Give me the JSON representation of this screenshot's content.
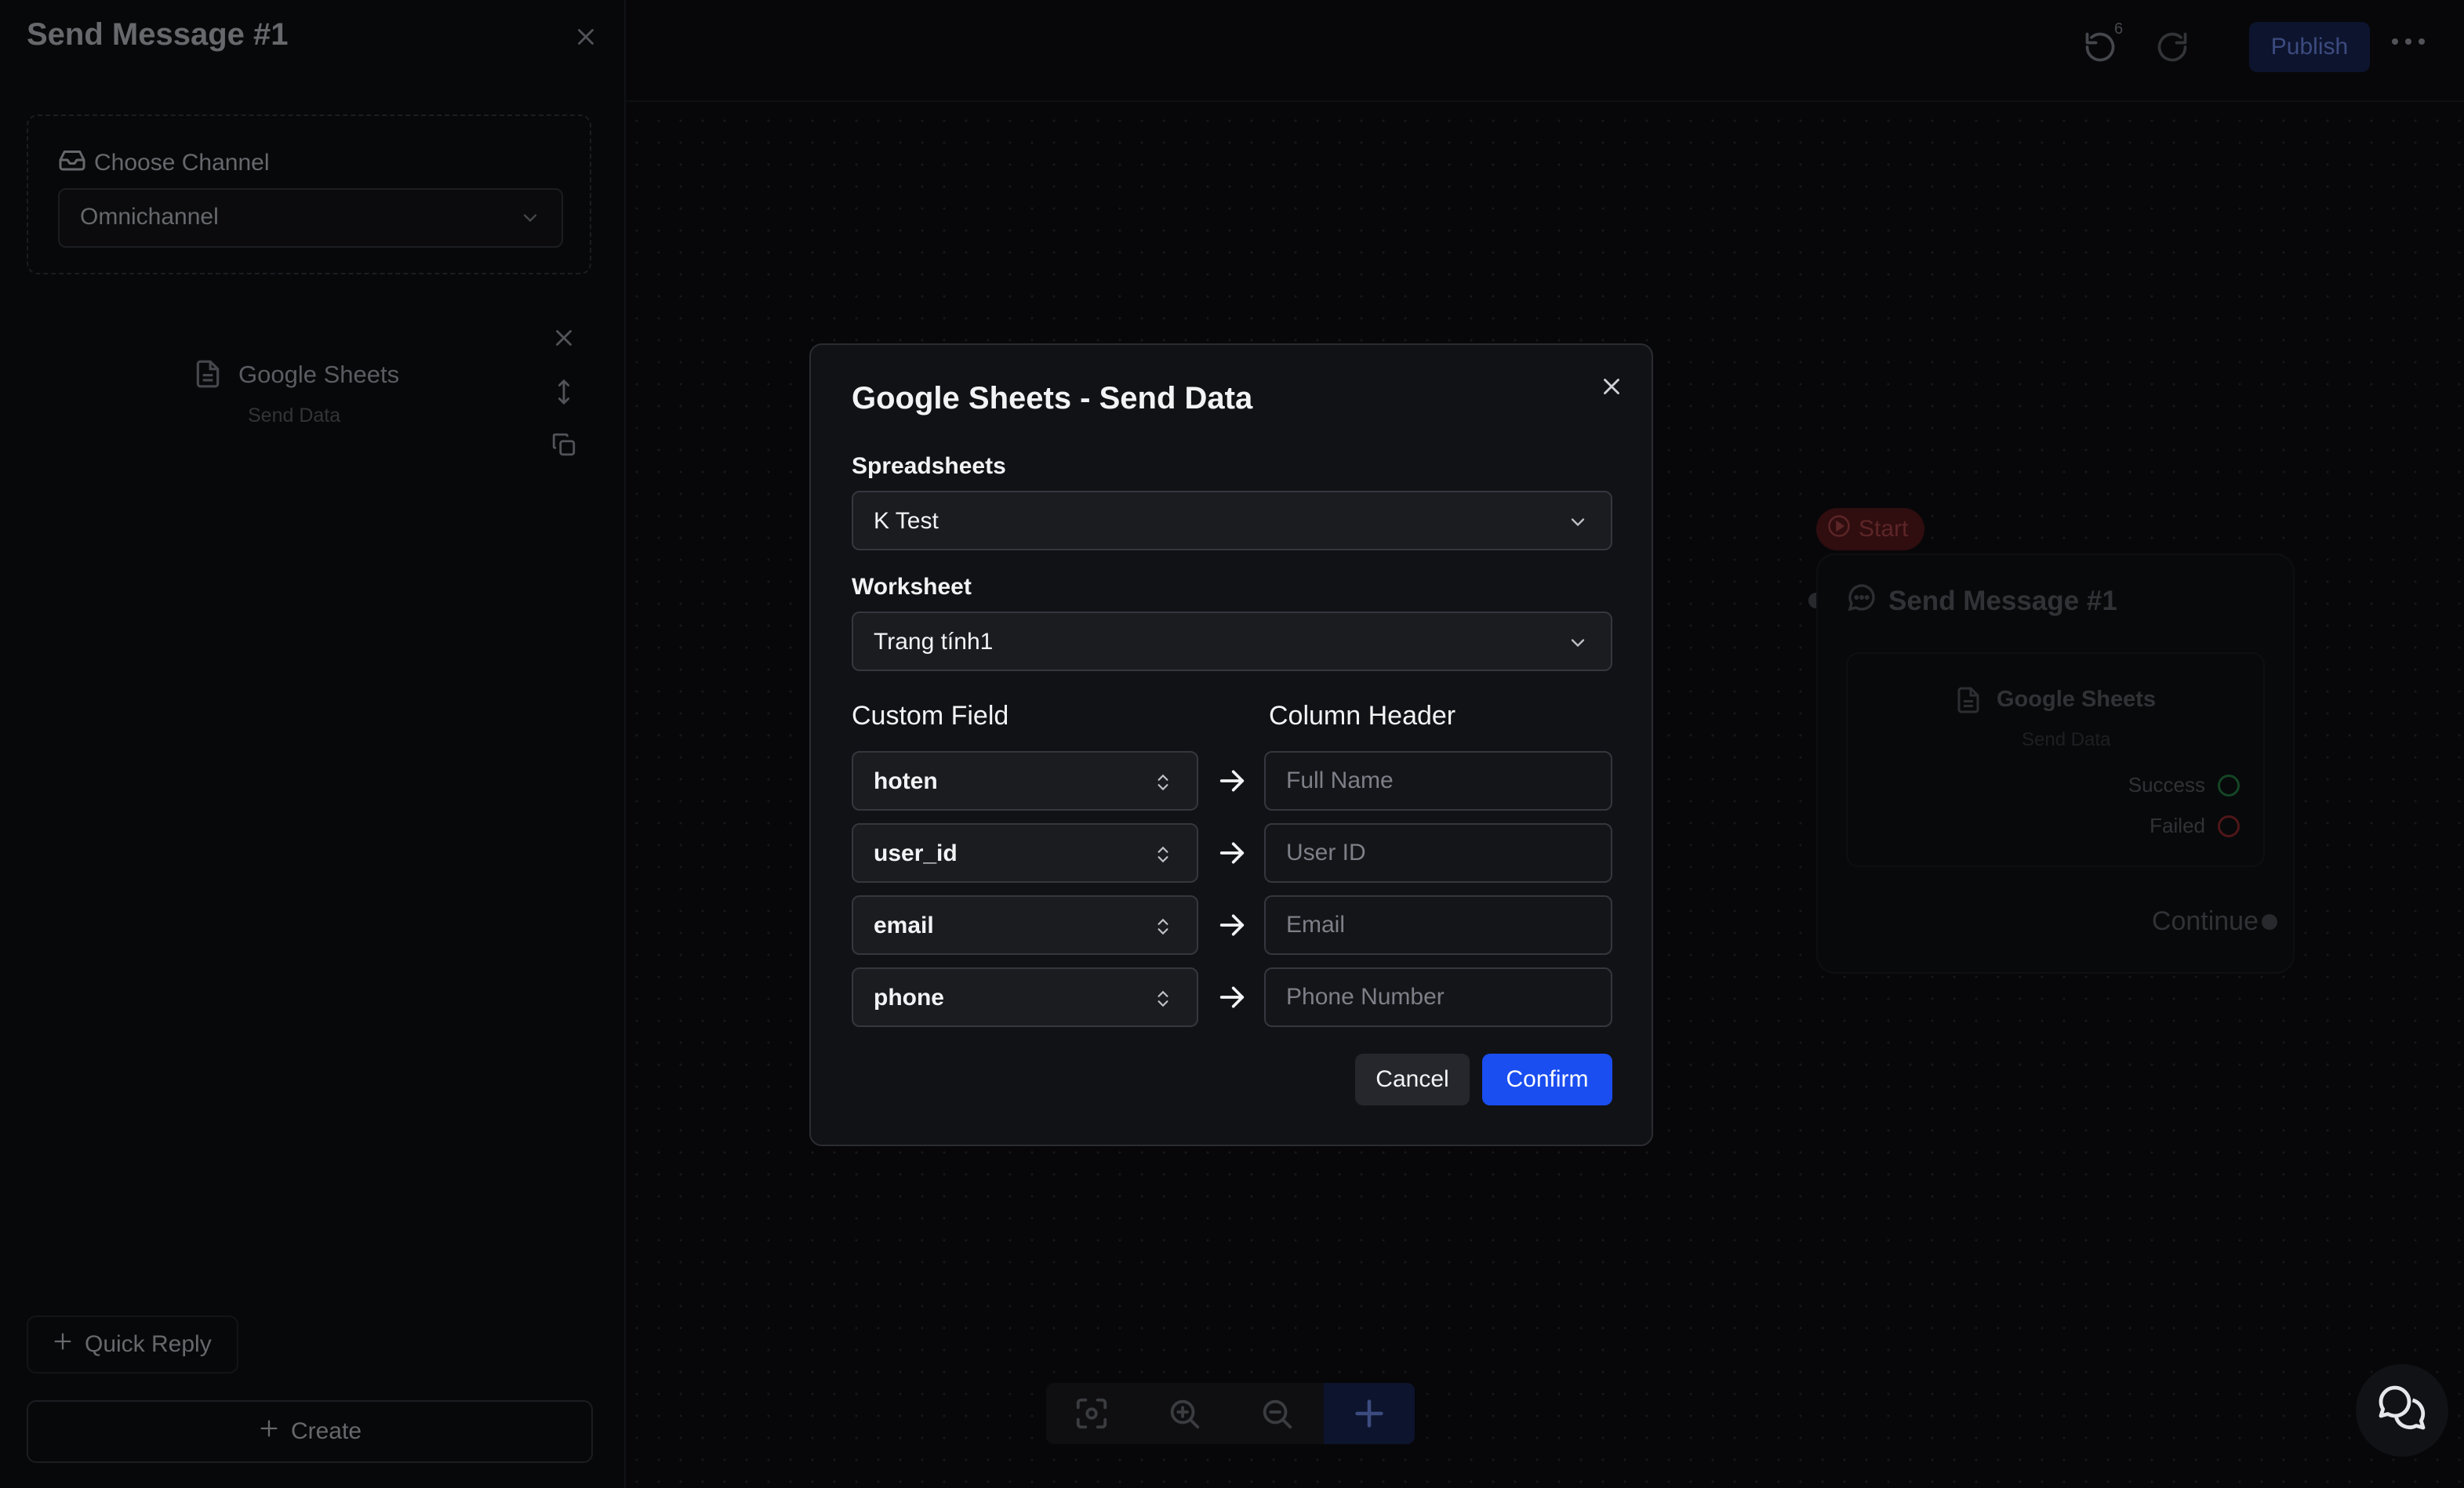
{
  "sidebar": {
    "title": "Send Message #1",
    "channel_label": "Choose Channel",
    "channel_value": "Omnichannel",
    "block_title": "Google Sheets",
    "block_subtitle": "Send Data",
    "quick_reply_label": "Quick Reply",
    "create_label": "Create"
  },
  "topbar": {
    "undo_count": "6",
    "publish_label": "Publish"
  },
  "flow": {
    "start_label": "Start",
    "node_title": "Send Message #1",
    "node_block_title": "Google Sheets",
    "node_block_subtitle": "Send Data",
    "success_label": "Success",
    "failed_label": "Failed",
    "continue_label": "Continue"
  },
  "modal": {
    "title": "Google Sheets - Send Data",
    "spreadsheets_label": "Spreadsheets",
    "spreadsheets_value": "K Test",
    "worksheet_label": "Worksheet",
    "worksheet_value": "Trang tính1",
    "custom_field_header": "Custom Field",
    "column_header_header": "Column Header",
    "rows": [
      {
        "field": "hoten",
        "placeholder": "Full Name"
      },
      {
        "field": "user_id",
        "placeholder": "User ID"
      },
      {
        "field": "email",
        "placeholder": "Email"
      },
      {
        "field": "phone",
        "placeholder": "Phone Number"
      }
    ],
    "cancel_label": "Cancel",
    "confirm_label": "Confirm"
  },
  "colors": {
    "confirm": "#1a4ef0",
    "publish": "#142048",
    "start_badge": "#4a1518",
    "success_ring": "#1f6b3a",
    "failed_ring": "#7a2326"
  }
}
